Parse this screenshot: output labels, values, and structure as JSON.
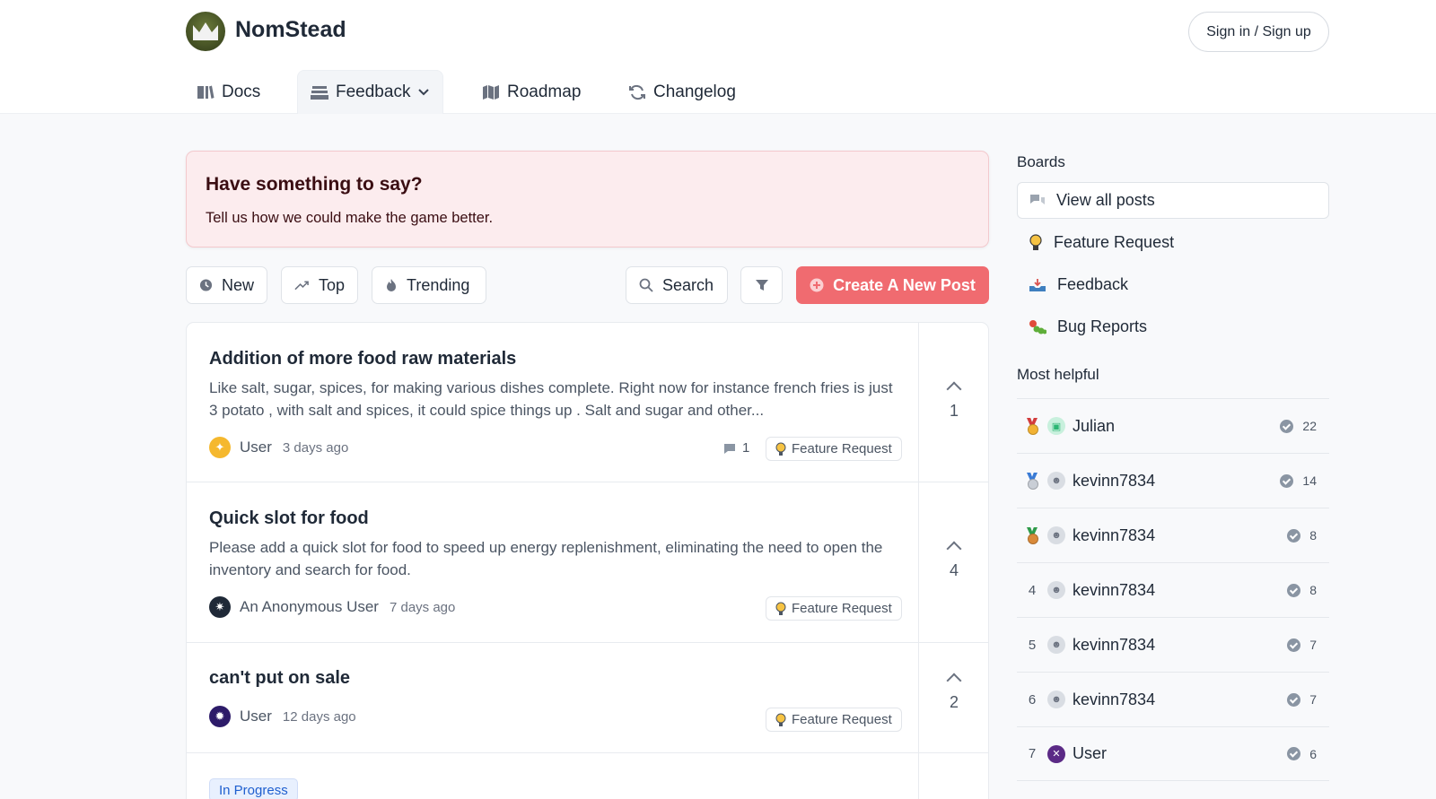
{
  "app": {
    "name": "NomStead",
    "signin_label": "Sign in / Sign up"
  },
  "nav": [
    {
      "label": "Docs",
      "icon": "book-icon"
    },
    {
      "label": "Feedback",
      "icon": "inbox-stack-icon"
    },
    {
      "label": "Roadmap",
      "icon": "map-icon"
    },
    {
      "label": "Changelog",
      "icon": "refresh-icon"
    }
  ],
  "banner": {
    "title": "Have something to say?",
    "text": "Tell us how we could make the game better."
  },
  "toolbar": {
    "new": "New",
    "top": "Top",
    "trending": "Trending",
    "search": "Search",
    "create": "Create A New Post"
  },
  "posts": [
    {
      "title": "Addition of more food raw materials",
      "body": "Like salt, sugar, spices, for making various dishes complete. Right now for instance french fries is just 3 potato , with salt and spices, it could spice things up . Salt and sugar and other...",
      "author": "User",
      "time": "3 days ago",
      "comments": "1",
      "tag": "Feature Request",
      "votes": "1"
    },
    {
      "title": "Quick slot for food",
      "body": "Please add a quick slot for food to speed up energy replenishment, eliminating the need to open the inventory and search for food.",
      "author": "An Anonymous User",
      "time": "7 days ago",
      "tag": "Feature Request",
      "votes": "4"
    },
    {
      "title": "can't put on sale",
      "author": "User",
      "time": "12 days ago",
      "tag": "Feature Request",
      "votes": "2"
    }
  ],
  "status_badge": "In Progress",
  "sidebar": {
    "boards_heading": "Boards",
    "boards": [
      {
        "label": "View all posts",
        "icon": "chat-bubbles-icon"
      },
      {
        "label": "Feature Request",
        "icon": "lightbulb-icon"
      },
      {
        "label": "Feedback",
        "icon": "inbox-tray-icon"
      },
      {
        "label": "Bug Reports",
        "icon": "caterpillar-icon"
      }
    ],
    "helpful_heading": "Most helpful",
    "helpful": [
      {
        "rank": "",
        "medal": "gold",
        "name": "Julian",
        "score": "22"
      },
      {
        "rank": "",
        "medal": "silver",
        "name": "kevinn7834",
        "score": "14"
      },
      {
        "rank": "",
        "medal": "bronze",
        "name": "kevinn7834",
        "score": "8"
      },
      {
        "rank": "4",
        "name": "kevinn7834",
        "score": "8"
      },
      {
        "rank": "5",
        "name": "kevinn7834",
        "score": "7"
      },
      {
        "rank": "6",
        "name": "kevinn7834",
        "score": "7"
      },
      {
        "rank": "7",
        "name": "User",
        "score": "6"
      }
    ]
  },
  "colors": {
    "accent": "#f06b70",
    "banner_bg": "#fcecee",
    "status_blue": "#1f5fcf"
  }
}
